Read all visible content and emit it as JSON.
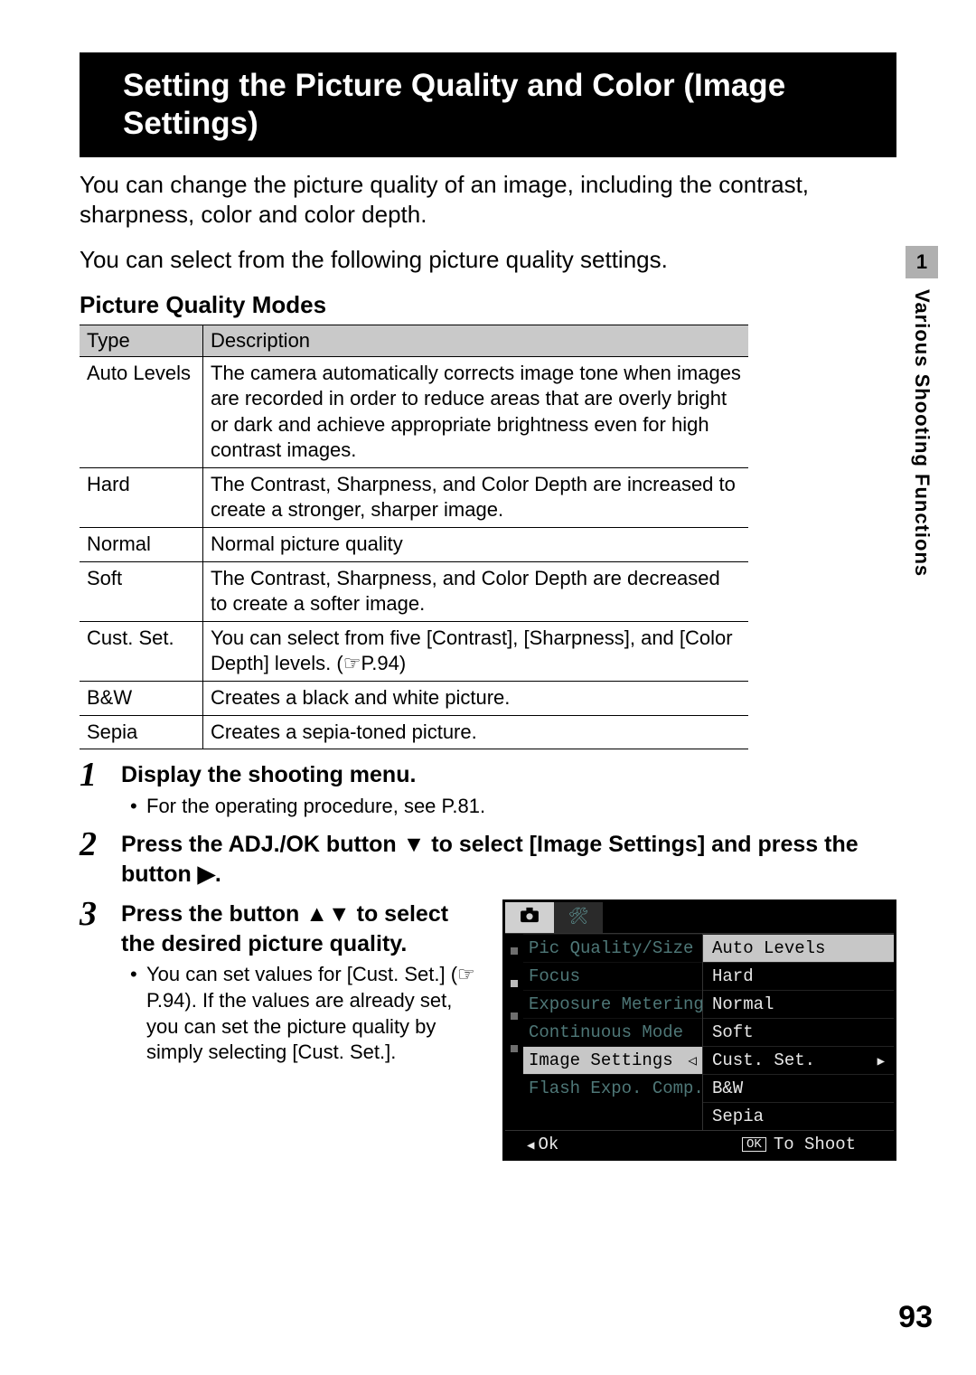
{
  "title": "Setting the Picture Quality and Color (Image Settings)",
  "intro_1": "You can change the picture quality of an image, including the contrast, sharpness, color and color depth.",
  "intro_2": "You can select from the following picture quality settings.",
  "table_title": "Picture Quality Modes",
  "table": {
    "head_type": "Type",
    "head_desc": "Description",
    "rows": [
      {
        "type": "Auto Levels",
        "desc": "The camera automatically corrects image tone when images are recorded in order to reduce areas that are overly bright or dark and achieve appropriate brightness even for high contrast images."
      },
      {
        "type": "Hard",
        "desc": "The Contrast, Sharpness, and Color Depth are increased to create a stronger, sharper image."
      },
      {
        "type": "Normal",
        "desc": "Normal picture quality"
      },
      {
        "type": "Soft",
        "desc": "The Contrast, Sharpness, and Color Depth are decreased to create a softer image."
      },
      {
        "type": "Cust. Set.",
        "desc": "You can select from five [Contrast], [Sharpness], and [Color Depth] levels. (☞P.94)"
      },
      {
        "type": "B&W",
        "desc": "Creates a black and white picture."
      },
      {
        "type": "Sepia",
        "desc": "Creates a sepia-toned picture."
      }
    ]
  },
  "steps": {
    "s1_head": "Display the shooting menu.",
    "s1_body": "For the operating procedure, see P.81.",
    "s2_head_a": "Press the ADJ./OK button ",
    "s2_head_b": " to select [Image Settings] and press the button ",
    "s2_head_c": ".",
    "s3_head_a": "Press the button ",
    "s3_head_b": " to select the desired picture quality.",
    "s3_body": "You can set values for [Cust. Set.] (☞P.94). If the values are already set, you can set the picture quality by simply selecting [Cust. Set.]."
  },
  "lcd": {
    "left_items": [
      "Pic Quality/Size",
      "Focus",
      "Exposure Metering",
      "Continuous Mode",
      "Image Settings",
      "Flash Expo. Comp."
    ],
    "left_selected_index": 4,
    "right_items": [
      "Auto Levels",
      "Hard",
      "Normal",
      "Soft",
      "Cust. Set.",
      "B&W",
      "Sepia"
    ],
    "right_highlight_index": 0,
    "right_arrow_index": 4,
    "bottom_left": "Ok",
    "bottom_ok": "OK",
    "bottom_right": "To Shoot"
  },
  "side": {
    "num": "1",
    "text": "Various Shooting Functions"
  },
  "page_number": "93"
}
